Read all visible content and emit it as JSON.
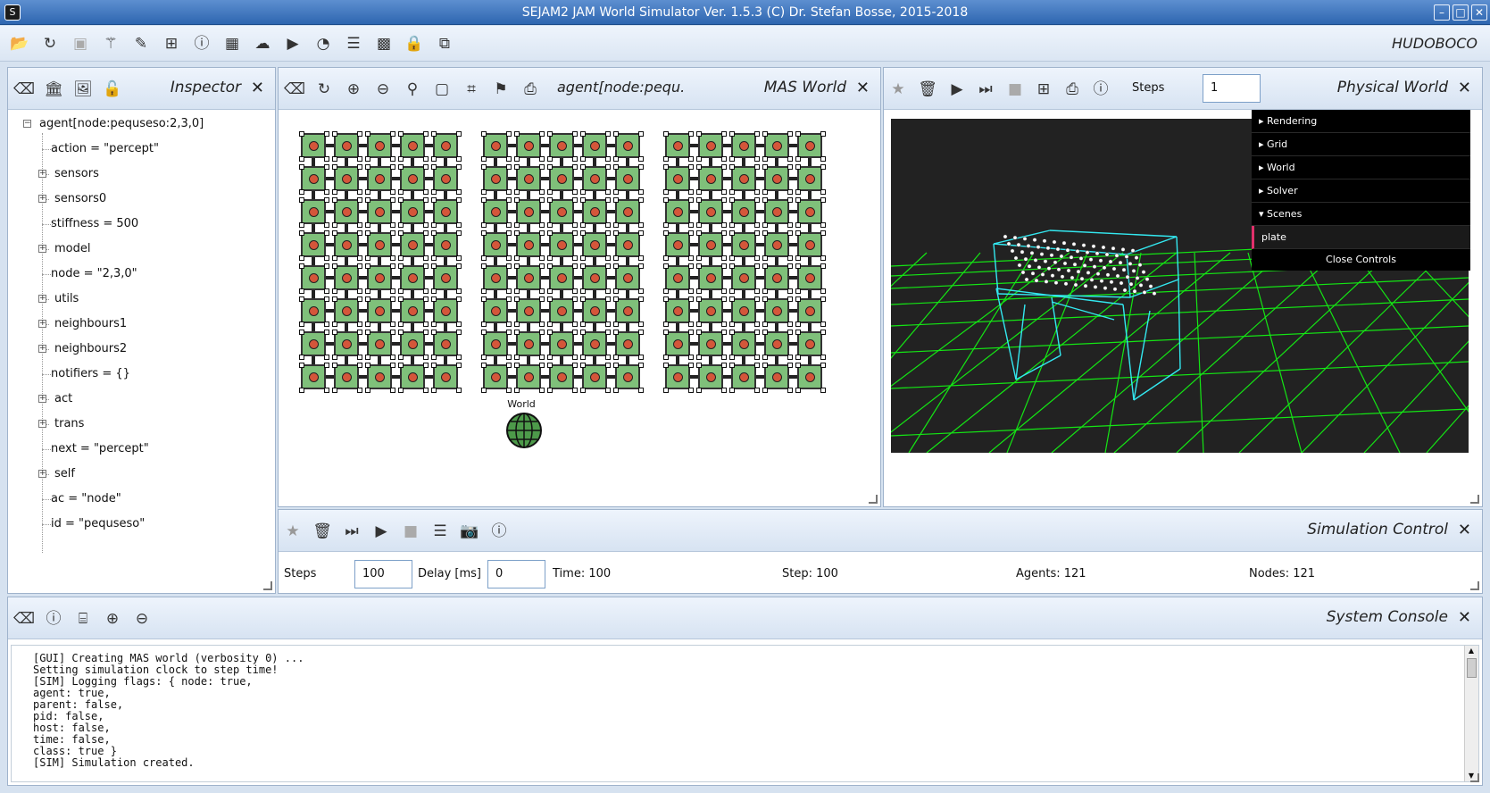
{
  "window": {
    "title": "SEJAM2 JAM World Simulator Ver. 1.5.3 (C) Dr. Stefan Bosse, 2015-2018"
  },
  "toolbar": {
    "brand": "HUDOBOCO"
  },
  "inspector": {
    "title": "Inspector",
    "root": "agent[node:pequseso:2,3,0]",
    "items": [
      {
        "label": "action = \"percept\"",
        "expandable": false
      },
      {
        "label": "sensors",
        "expandable": true
      },
      {
        "label": "sensors0",
        "expandable": true
      },
      {
        "label": "stiffness = 500",
        "expandable": false
      },
      {
        "label": "model",
        "expandable": true
      },
      {
        "label": "node = \"2,3,0\"",
        "expandable": false
      },
      {
        "label": "utils",
        "expandable": true
      },
      {
        "label": "neighbours1",
        "expandable": true
      },
      {
        "label": "neighbours2",
        "expandable": true
      },
      {
        "label": "notifiers = {}",
        "expandable": false
      },
      {
        "label": "act",
        "expandable": true
      },
      {
        "label": "trans",
        "expandable": true
      },
      {
        "label": "next = \"percept\"",
        "expandable": false
      },
      {
        "label": "self",
        "expandable": true
      },
      {
        "label": "ac = \"node\"",
        "expandable": false
      },
      {
        "label": "id = \"pequseso\"",
        "expandable": false
      }
    ]
  },
  "mas_world": {
    "title": "MAS World",
    "selection": "agent[node:pequ.",
    "world_label": "World",
    "grid": {
      "blocks": 3,
      "rows": 8,
      "cols": 5
    }
  },
  "physical_world": {
    "title": "Physical World",
    "steps_label": "Steps",
    "steps_value": "1",
    "controls": [
      {
        "label": "Rendering",
        "open": false
      },
      {
        "label": "Grid",
        "open": false
      },
      {
        "label": "World",
        "open": false
      },
      {
        "label": "Solver",
        "open": false
      },
      {
        "label": "Scenes",
        "open": true
      }
    ],
    "scene_item": "plate",
    "close_controls": "Close Controls",
    "colors": {
      "grid": "#14e614",
      "wire": "#33e8f0",
      "background": "#222222"
    }
  },
  "sim_control": {
    "title": "Simulation Control",
    "steps_label": "Steps",
    "steps_value": "100",
    "delay_label": "Delay [ms]",
    "delay_value": "0",
    "time": "Time: 100",
    "step": "Step: 100",
    "agents": "Agents: 121",
    "nodes": "Nodes: 121"
  },
  "console": {
    "title": "System Console",
    "lines": [
      "[GUI] Creating MAS world (verbosity 0) ...",
      "Setting simulation clock to step time!",
      "[SIM] Logging flags: { node: true,",
      "agent: true,",
      "parent: false,",
      "pid: false,",
      "host: false,",
      "time: false,",
      "class: true }",
      "[SIM] Simulation created."
    ]
  }
}
